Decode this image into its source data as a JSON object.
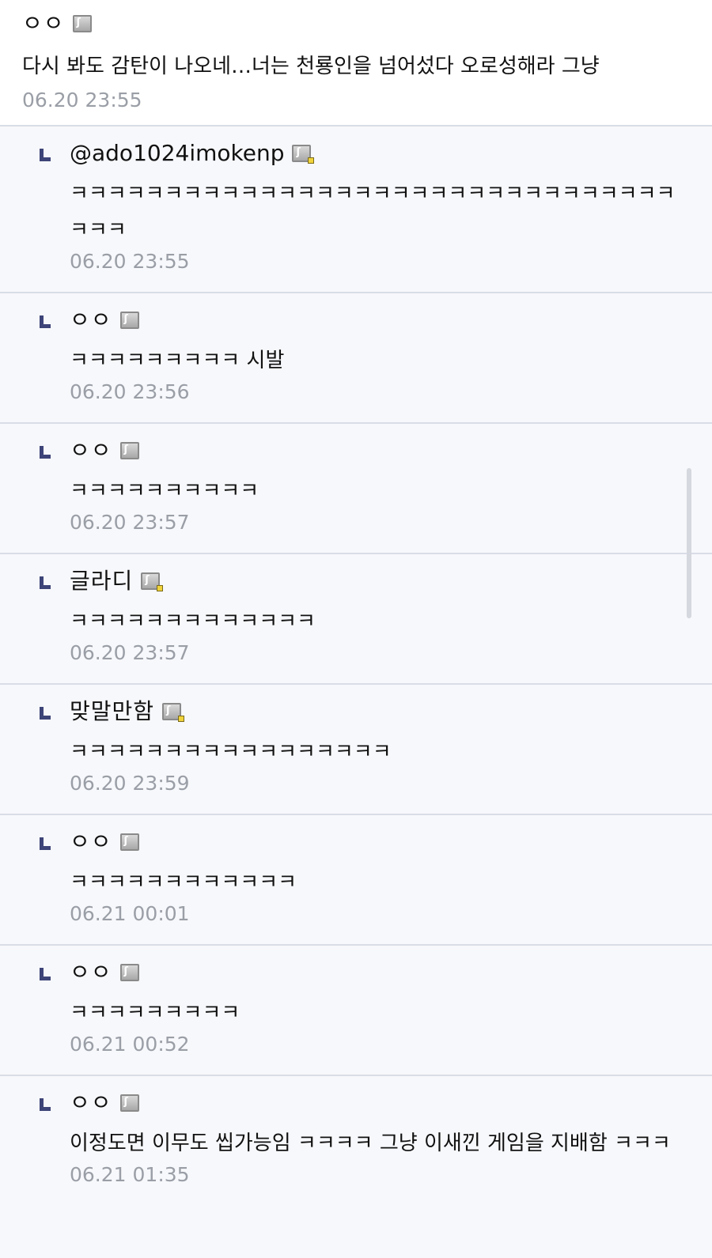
{
  "top_comment": {
    "author": "ㅇㅇ",
    "text": "다시 봐도 감탄이 나오네…너는 천룡인을 넘어섰다 오로성해라 그냥",
    "time": "06.20 23:55"
  },
  "replies": [
    {
      "author": "@ado1024imokenp",
      "badge": "fixed-nick",
      "text": "ㅋㅋㅋㅋㅋㅋㅋㅋㅋㅋㅋㅋㅋㅋㅋㅋㅋㅋㅋㅋㅋㅋㅋㅋㅋㅋㅋㅋㅋㅋㅋㅋㅋㅋㅋ",
      "time": "06.20 23:55"
    },
    {
      "author": "ㅇㅇ",
      "badge": "floating",
      "text": "ㅋㅋㅋㅋㅋㅋㅋㅋㅋ 시발",
      "time": "06.20 23:56"
    },
    {
      "author": "ㅇㅇ",
      "badge": "floating",
      "text": "ㅋㅋㅋㅋㅋㅋㅋㅋㅋㅋ",
      "time": "06.20 23:57"
    },
    {
      "author": "글라디",
      "badge": "fixed-nick",
      "text": "ㅋㅋㅋㅋㅋㅋㅋㅋㅋㅋㅋㅋㅋ",
      "time": "06.20 23:57"
    },
    {
      "author": "맞말만함",
      "badge": "fixed-nick",
      "text": "ㅋㅋㅋㅋㅋㅋㅋㅋㅋㅋㅋㅋㅋㅋㅋㅋㅋ",
      "time": "06.20 23:59"
    },
    {
      "author": "ㅇㅇ",
      "badge": "floating",
      "text": "ㅋㅋㅋㅋㅋㅋㅋㅋㅋㅋㅋㅋ",
      "time": "06.21 00:01"
    },
    {
      "author": "ㅇㅇ",
      "badge": "floating",
      "text": "ㅋㅋㅋㅋㅋㅋㅋㅋㅋ",
      "time": "06.21 00:52"
    },
    {
      "author": "ㅇㅇ",
      "badge": "floating",
      "text": "이정도면 이무도 씹가능임 ㅋㅋㅋㅋ 그냥 이새낀 게임을 지배함 ㅋㅋㅋ",
      "time": "06.21 01:35"
    }
  ],
  "colors": {
    "reply_arrow": "#3d4478",
    "timestamp": "#9a9ea6",
    "divider": "#d9dde6",
    "badge_dot": "#f0d33a"
  },
  "icons": {
    "badge": "gallery-user-icon",
    "reply": "reply-arrow-icon"
  }
}
